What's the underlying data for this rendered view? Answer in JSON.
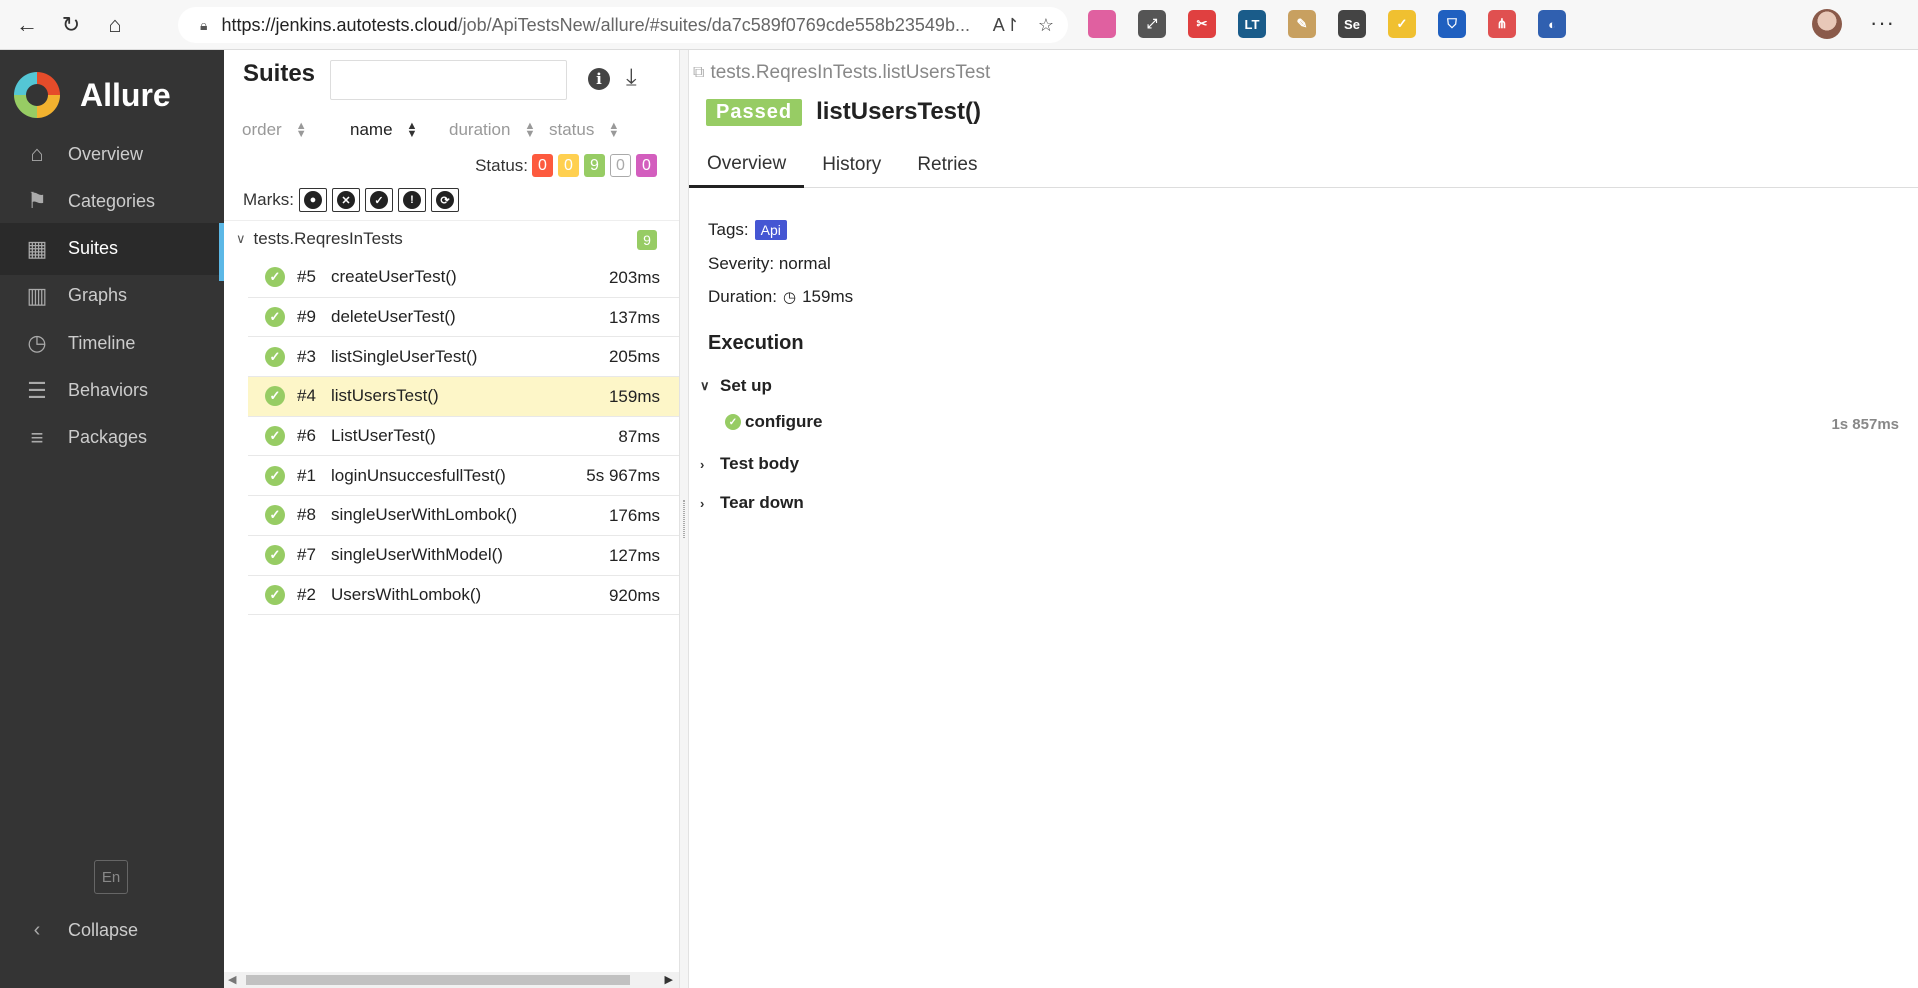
{
  "browser": {
    "url_host": "https://jenkins.autotests.cloud",
    "url_path": "/job/ApiTestsNew/allure/#suites/da7c589f0769cde558b23549b...",
    "icons": [
      "back-icon",
      "reload-icon",
      "home-icon",
      "lock-icon",
      "read-aloud-icon",
      "favorite-add-icon",
      "extensions-icon",
      "favorites-icon",
      "collections-icon",
      "more-icon"
    ],
    "extensions": [
      {
        "name": "color-ext",
        "label": "",
        "color": "#e060a0"
      },
      {
        "name": "resize-ext",
        "label": "⤢",
        "color": "#555555"
      },
      {
        "name": "tool-ext",
        "label": "✂",
        "color": "#e04040"
      },
      {
        "name": "lt-ext",
        "label": "LT",
        "color": "#1a5c8a"
      },
      {
        "name": "note-ext",
        "label": "✎",
        "color": "#c8a060"
      },
      {
        "name": "selenium-ext",
        "label": "Se",
        "color": "#444444"
      },
      {
        "name": "katalon-ext",
        "label": "✓",
        "color": "#f0c030"
      },
      {
        "name": "shield-ext",
        "label": "⛉",
        "color": "#2060c0"
      },
      {
        "name": "tree-ext",
        "label": "⋔",
        "color": "#e05050"
      },
      {
        "name": "edge-ext",
        "label": "◐",
        "color": "#3060b0"
      }
    ],
    "more_label": "···"
  },
  "sidebar": {
    "brand": "Allure",
    "items": [
      {
        "label": "Overview",
        "icon": "home-icon",
        "glyph": "⌂"
      },
      {
        "label": "Categories",
        "icon": "flag-icon",
        "glyph": "⚑"
      },
      {
        "label": "Suites",
        "icon": "briefcase-icon",
        "glyph": "▦"
      },
      {
        "label": "Graphs",
        "icon": "bar-chart-icon",
        "glyph": "▥"
      },
      {
        "label": "Timeline",
        "icon": "clock-icon",
        "glyph": "◷"
      },
      {
        "label": "Behaviors",
        "icon": "list-icon",
        "glyph": "☰"
      },
      {
        "label": "Packages",
        "icon": "align-left-icon",
        "glyph": "≡"
      }
    ],
    "active": "Suites",
    "lang": "En",
    "collapse_label": "Collapse"
  },
  "suites": {
    "title": "Suites",
    "search_placeholder": "",
    "sort_columns": [
      "order",
      "name",
      "duration",
      "status"
    ],
    "sort_active": "name",
    "status_label": "Status:",
    "status_counts": [
      {
        "kind": "failed",
        "value": "0"
      },
      {
        "kind": "broken",
        "value": "0"
      },
      {
        "kind": "passed",
        "value": "9"
      },
      {
        "kind": "skipped",
        "value": "0"
      },
      {
        "kind": "unknown",
        "value": "0"
      }
    ],
    "marks_label": "Marks:",
    "marks": [
      {
        "name": "flaky-mark-icon",
        "glyph": "●"
      },
      {
        "name": "new-failed-mark-icon",
        "glyph": "✕"
      },
      {
        "name": "new-passed-mark-icon",
        "glyph": "✓"
      },
      {
        "name": "new-broken-mark-icon",
        "glyph": "!"
      },
      {
        "name": "retries-mark-icon",
        "glyph": "⟳"
      }
    ],
    "group": {
      "name": "tests.ReqresInTests",
      "count": "9"
    },
    "tests": [
      {
        "order": "#5",
        "name": "createUserTest()",
        "duration": "203ms"
      },
      {
        "order": "#9",
        "name": "deleteUserTest()",
        "duration": "137ms"
      },
      {
        "order": "#3",
        "name": "listSingleUserTest()",
        "duration": "205ms"
      },
      {
        "order": "#4",
        "name": "listUsersTest()",
        "duration": "159ms"
      },
      {
        "order": "#6",
        "name": "ListUserTest()",
        "duration": "87ms"
      },
      {
        "order": "#1",
        "name": "loginUnsuccesfullTest()",
        "duration": "5s 967ms"
      },
      {
        "order": "#8",
        "name": "singleUserWithLombok()",
        "duration": "176ms"
      },
      {
        "order": "#7",
        "name": "singleUserWithModel()",
        "duration": "127ms"
      },
      {
        "order": "#2",
        "name": "UsersWithLombok()",
        "duration": "920ms"
      }
    ],
    "selected_index": 3
  },
  "details": {
    "breadcrumb": "tests.ReqresInTests.listUsersTest",
    "status": "Passed",
    "title": "listUsersTest()",
    "tabs": [
      "Overview",
      "History",
      "Retries"
    ],
    "active_tab": "Overview",
    "tags_label": "Tags:",
    "tag": "Api",
    "severity": "Severity: normal",
    "duration_label": "Duration:",
    "duration_value": "159ms",
    "execution_title": "Execution",
    "steps": [
      {
        "label": "Set up",
        "expanded": true
      },
      {
        "label": "Test body",
        "expanded": false
      },
      {
        "label": "Tear down",
        "expanded": false
      }
    ],
    "setup_child": {
      "label": "configure",
      "duration": "1s 857ms"
    }
  },
  "colors": {
    "sidebar_bg": "#343434",
    "accent": "#5cb8e6",
    "passed": "#97cc64",
    "failed": "#fd5a3e",
    "broken": "#ffd050",
    "unknown": "#d35ebe",
    "tag": "#4556d3"
  }
}
